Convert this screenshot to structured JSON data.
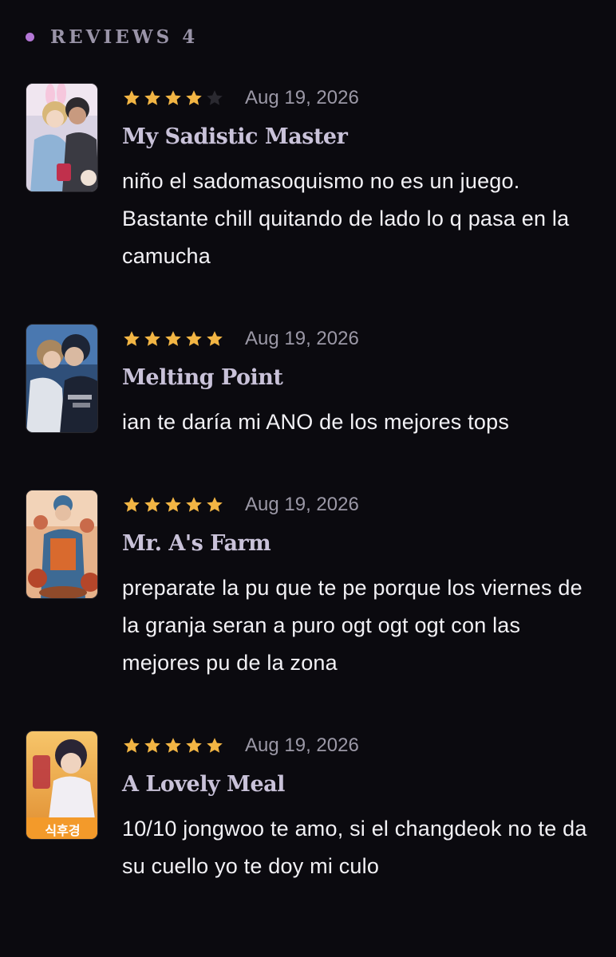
{
  "header": {
    "title": "REVIEWS",
    "count": "4"
  },
  "reviews": [
    {
      "title": "My Sadistic Master",
      "date": "Aug 19, 2026",
      "rating": 4,
      "max_rating": 5,
      "text": "niño el sadomasoquismo no es un juego. Bastante chill quitando de lado lo q pasa en la camucha"
    },
    {
      "title": "Melting Point",
      "date": "Aug 19, 2026",
      "rating": 5,
      "max_rating": 5,
      "text": "ian te daría mi ANO de los mejores tops"
    },
    {
      "title": "Mr. A's Farm",
      "date": "Aug 19, 2026",
      "rating": 5,
      "max_rating": 5,
      "text": "preparate la pu que te pe porque los viernes de la granja seran a puro ogt ogt ogt con las mejores pu de la zona"
    },
    {
      "title": "A Lovely Meal",
      "date": "Aug 19, 2026",
      "rating": 5,
      "max_rating": 5,
      "text": "10/10 jongwoo te amo, si el changdeok no te da su cuello yo te doy mi culo",
      "cover_text": "식후경"
    }
  ],
  "colors": {
    "background": "#0b0a0f",
    "accent_dot": "#b477d6",
    "star_filled": "#f2b544",
    "star_empty": "#2a2930",
    "title": "#c9c2d9",
    "date": "#9b98a6",
    "text": "#f2f1f5"
  }
}
